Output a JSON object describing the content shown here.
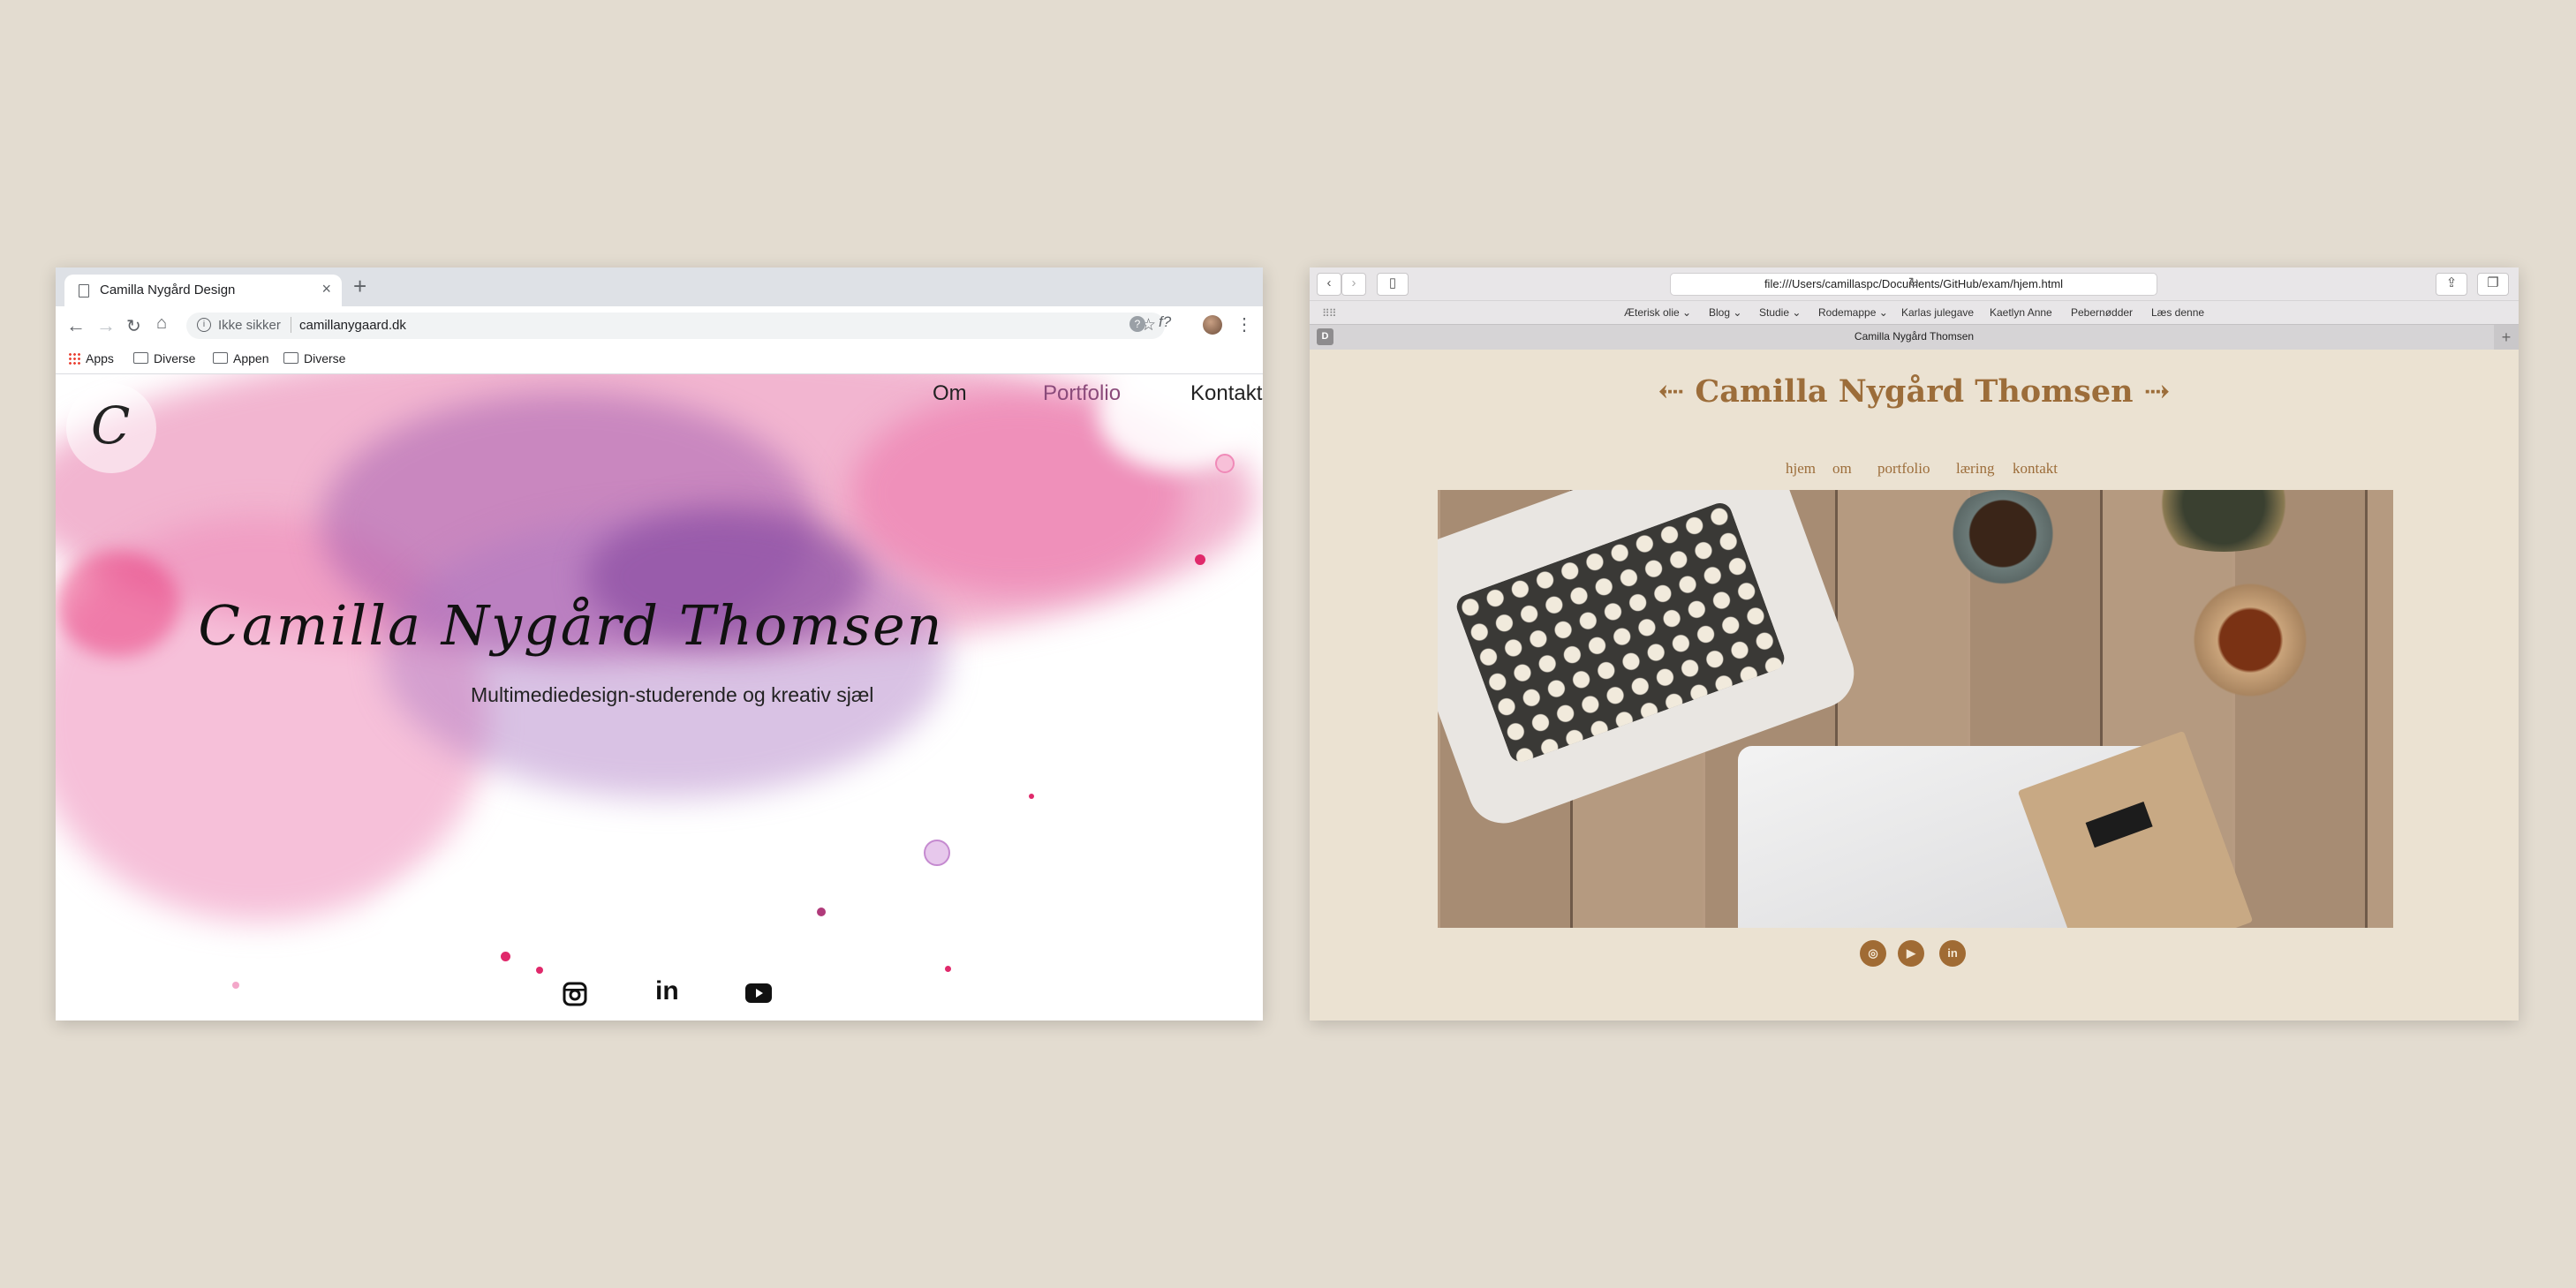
{
  "chrome": {
    "tab_title": "Camilla Nygård Design",
    "new_tab": "+",
    "omnibox": {
      "security": "Ikke sikker",
      "url": "camillanygaard.dk"
    },
    "ext_label": "f?",
    "bookmarks": [
      "Apps",
      "Diverse",
      "Appen",
      "Diverse"
    ],
    "page": {
      "logo_letter": "C",
      "nav": [
        "Om",
        "Portfolio",
        "Kontakt"
      ],
      "name": "Camilla Nygård Thomsen",
      "subtitle": "Multimediedesign-studerende og kreativ sjæl",
      "social": [
        "instagram",
        "linkedin",
        "youtube"
      ]
    }
  },
  "safari": {
    "url": "file:///Users/camillaspc/Documents/GitHub/exam/hjem.html",
    "favorites": [
      "Æterisk olie",
      "Blog",
      "Studie",
      "Rodemappe",
      "Karlas julegave",
      "Kaetlyn Anne",
      "Pebernødder",
      "Læs denne"
    ],
    "tab_badge": "D",
    "tab_title": "Camilla Nygård Thomsen",
    "page": {
      "title": "Camilla Nygård Thomsen",
      "nav": [
        "hjem",
        "om",
        "portfolio",
        "læring",
        "kontakt"
      ],
      "social": [
        "instagram",
        "youtube",
        "linkedin"
      ]
    }
  },
  "colors": {
    "background": "#e3dcd0",
    "safari_page": "#ebe2d2",
    "brown_accent": "#9c6d3a",
    "splash_pink": "#e85a94",
    "splash_purple": "#7b3f9e"
  }
}
